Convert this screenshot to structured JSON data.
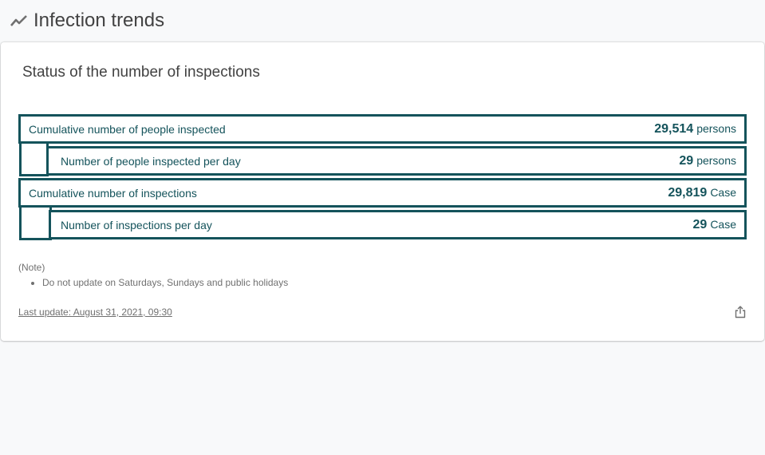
{
  "page": {
    "title": "Infection trends",
    "icon": "trending-line-icon"
  },
  "card": {
    "title": "Status of the number of inspections",
    "accent_color": "#14535b",
    "stats": [
      {
        "label": "Cumulative number of people inspected",
        "value": "29,514",
        "unit": "persons"
      },
      {
        "label": "Number of people inspected per day",
        "value": "29",
        "unit": "persons"
      },
      {
        "label": "Cumulative number of inspections",
        "value": "29,819",
        "unit": "Case"
      },
      {
        "label": "Number of inspections per day",
        "value": "29",
        "unit": "Case"
      }
    ],
    "note": {
      "heading": "(Note)",
      "items": [
        "Do not update on Saturdays, Sundays and public holidays"
      ]
    },
    "last_update": "Last update: August 31, 2021, 09:30",
    "share_icon": "share-icon"
  }
}
